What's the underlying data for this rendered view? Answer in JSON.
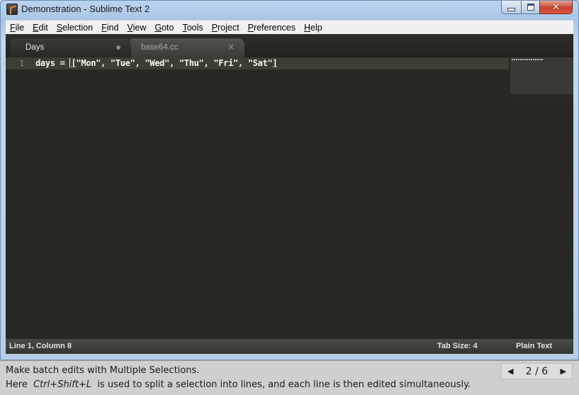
{
  "window": {
    "title": "Demonstration - Sublime Text 2",
    "controls": {
      "minimize_icon": "minimize-icon",
      "maximize_icon": "maximize-icon",
      "close_glyph": "✕"
    }
  },
  "menubar": {
    "items": [
      "File",
      "Edit",
      "Selection",
      "Find",
      "View",
      "Goto",
      "Tools",
      "Project",
      "Preferences",
      "Help"
    ]
  },
  "tabs": [
    {
      "label": "Days",
      "active": true,
      "modified": true
    },
    {
      "label": "base64.cc",
      "active": false,
      "close_glyph": "×"
    }
  ],
  "editor": {
    "line_number": "1",
    "code_before_caret": "days = ",
    "code_bracket_open": "[",
    "code_middle": "\"Mon\", \"Tue\", \"Wed\", \"Thu\", \"Fri\", \"Sat\"",
    "code_bracket_close": "]"
  },
  "statusbar": {
    "position": "Line 1, Column 8",
    "tab_size": "Tab Size: 4",
    "syntax": "Plain Text"
  },
  "caption": {
    "line1": "Make batch edits with Multiple Selections.",
    "line2_prefix": "Here",
    "shortcut": "Ctrl+Shift+L",
    "line2_suffix": "is used to split a selection into lines, and each line is then edited simultaneously."
  },
  "pager": {
    "prev_glyph": "◀",
    "page_text": "2 / 6",
    "next_glyph": "▶"
  },
  "colors": {
    "editor_background": "#272822",
    "line_highlight": "#3e3d32",
    "text": "#f8f8f2",
    "gutter_text": "#90908a"
  }
}
